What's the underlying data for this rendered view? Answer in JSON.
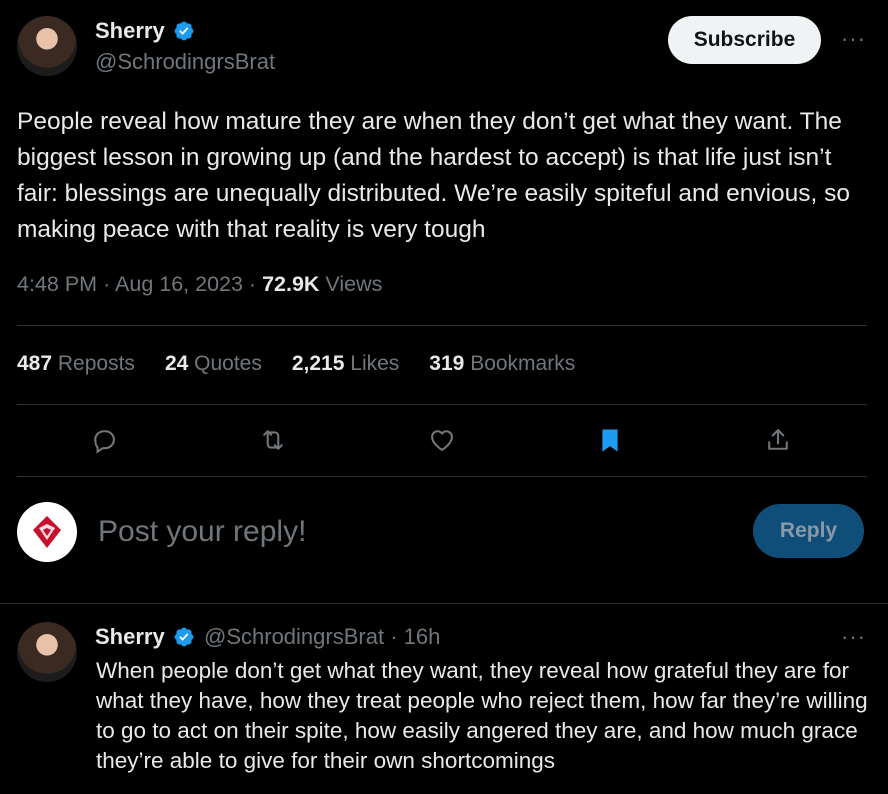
{
  "main_tweet": {
    "author_name": "Sherry",
    "handle": "@SchrodingrsBrat",
    "subscribe_label": "Subscribe",
    "more_label": "···",
    "text": "People reveal how mature they are when they don’t get what they want. The biggest lesson in growing up (and the hardest to accept) is that life just isn’t fair: blessings are unequally distributed. We’re easily spiteful and envious, so making peace with that reality is very tough",
    "time": "4:48 PM",
    "date": "Aug 16, 2023",
    "views_count": "72.9K",
    "views_label": "Views",
    "stats": {
      "reposts_count": "487",
      "reposts_label": "Reposts",
      "quotes_count": "24",
      "quotes_label": "Quotes",
      "likes_count": "2,215",
      "likes_label": "Likes",
      "bookmarks_count": "319",
      "bookmarks_label": "Bookmarks"
    },
    "actions": [
      "reply-icon",
      "repost-icon",
      "like-icon",
      "bookmark-icon",
      "share-icon"
    ],
    "bookmarked": true
  },
  "reply_box": {
    "placeholder": "Post your reply!",
    "button_label": "Reply"
  },
  "thread_reply": {
    "author_name": "Sherry",
    "handle": "@SchrodingrsBrat",
    "time_ago": "16h",
    "more_label": "···",
    "text": "When people don’t get what they want, they reveal how grateful they are for what they have, how they treat people who reject them, how far they’re willing to go to act on their spite, how easily angered they are, and how much grace they’re able to give for their own shortcomings"
  },
  "colors": {
    "background": "#000000",
    "text": "#e7e9ea",
    "secondary": "#71767b",
    "accent": "#1d9bf0",
    "divider": "#2f3336",
    "reply_button": "#0f4e78"
  }
}
